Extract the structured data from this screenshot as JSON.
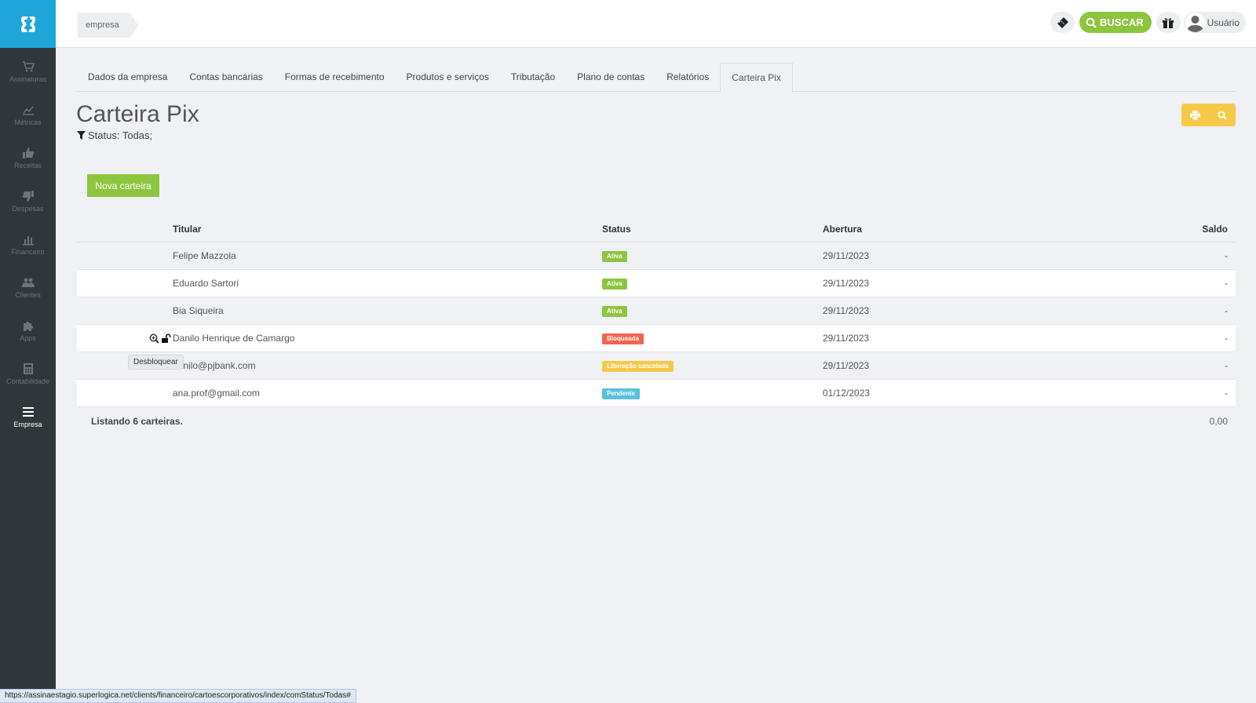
{
  "breadcrumb": "empresa",
  "topbar": {
    "search_label": "BUSCAR",
    "user_label": "Usuário"
  },
  "sidebar": {
    "items": [
      {
        "label": "Assinaturas",
        "icon": "cart-icon"
      },
      {
        "label": "Métricas",
        "icon": "chart-line-icon"
      },
      {
        "label": "Receitas",
        "icon": "thumbs-up-icon"
      },
      {
        "label": "Despesas",
        "icon": "thumbs-down-icon"
      },
      {
        "label": "Financeiro",
        "icon": "bar-chart-icon"
      },
      {
        "label": "Clientes",
        "icon": "users-icon"
      },
      {
        "label": "Apps",
        "icon": "puzzle-icon"
      },
      {
        "label": "Contabilidade",
        "icon": "calculator-icon"
      },
      {
        "label": "Empresa",
        "icon": "menu-icon"
      }
    ]
  },
  "tabs": [
    "Dados da empresa",
    "Contas bancárias",
    "Formas de recebimento",
    "Produtos e serviços",
    "Tributação",
    "Plano de contas",
    "Relatórios",
    "Carteira Pix"
  ],
  "page": {
    "title": "Carteira Pix",
    "filter_text": "Status: Todas;",
    "new_button": "Nova carteira"
  },
  "table": {
    "headers": {
      "titular": "Titular",
      "status": "Status",
      "abertura": "Abertura",
      "saldo": "Saldo"
    },
    "rows": [
      {
        "titular": "Felipe Mazzola",
        "status": "Ativa",
        "status_color": "#8cc63f",
        "abertura": "29/11/2023",
        "saldo": "-"
      },
      {
        "titular": "Eduardo Sartori",
        "status": "Ativa",
        "status_color": "#8cc63f",
        "abertura": "29/11/2023",
        "saldo": "-"
      },
      {
        "titular": "Bia Siqueira",
        "status": "Ativa",
        "status_color": "#8cc63f",
        "abertura": "29/11/2023",
        "saldo": "-"
      },
      {
        "titular": "Danilo Henrique de Camargo",
        "status": "Bloqueada",
        "status_color": "#f0654f",
        "abertura": "29/11/2023",
        "saldo": "-"
      },
      {
        "titular": "danilo@pjbank.com",
        "status": "Liberação cancelada",
        "status_color": "#f7c948",
        "abertura": "29/11/2023",
        "saldo": "-"
      },
      {
        "titular": "ana.prof@gmail.com",
        "status": "Pendente",
        "status_color": "#5bc0de",
        "abertura": "01/12/2023",
        "saldo": "-"
      }
    ],
    "footer_count": "Listando 6 carteiras.",
    "footer_total": "0,00"
  },
  "tooltip": "Desbloquear",
  "status_url": "https://assinaestagio.superlogica.net/clients/financeiro/cartoescorporativos/index/comStatus/Todas#"
}
